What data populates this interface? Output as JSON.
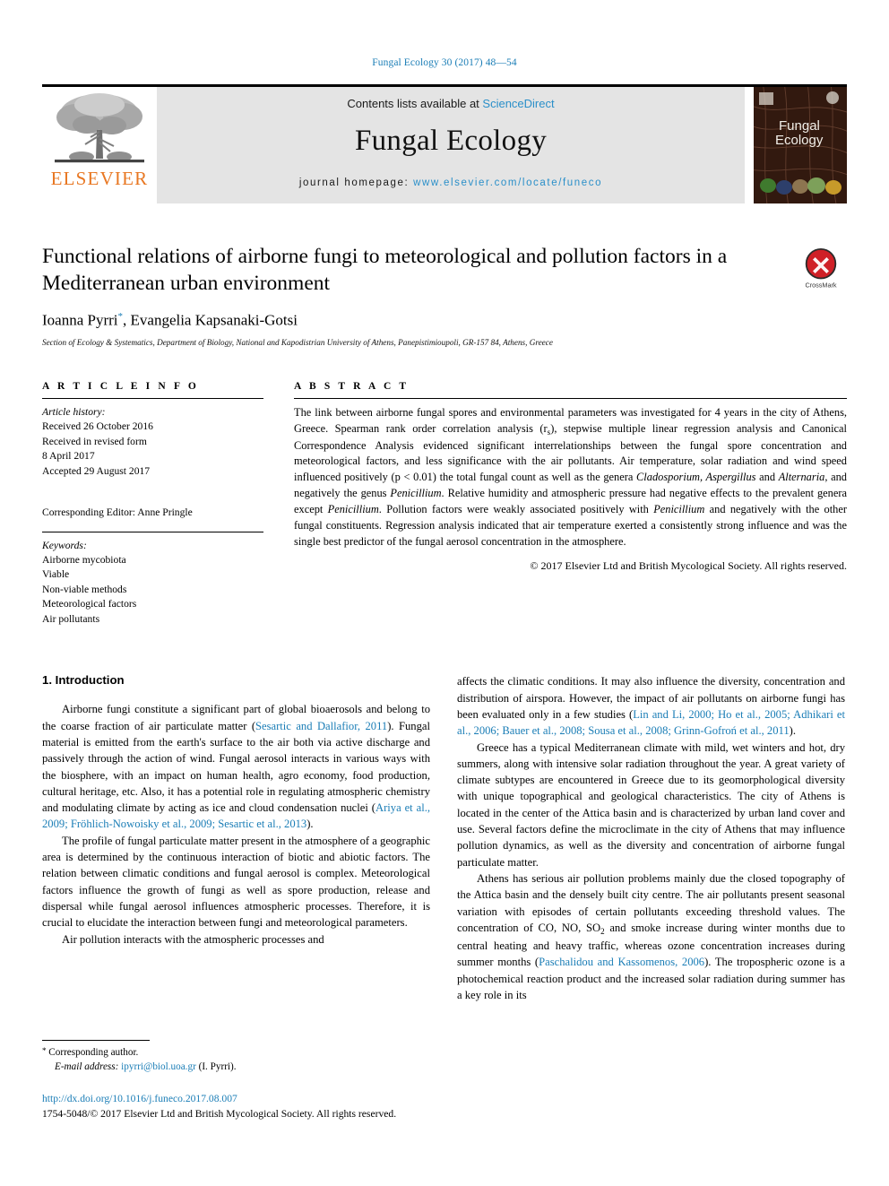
{
  "running_head": "Fungal Ecology 30 (2017) 48—54",
  "masthead": {
    "publisher": "ELSEVIER",
    "contents_prefix": "Contents lists available at ",
    "sciencedirect": "ScienceDirect",
    "journal_name": "Fungal Ecology",
    "homepage_prefix": "journal homepage: ",
    "homepage_url": "www.elsevier.com/locate/funeco",
    "cover_title_line1": "Fungal",
    "cover_title_line2": "Ecology",
    "crossmark_label": "CrossMark"
  },
  "article": {
    "title": "Functional relations of airborne fungi to meteorological and pollution factors in a Mediterranean urban environment",
    "authors": "Ioanna Pyrri",
    "authors_rest": ", Evangelia Kapsanaki-Gotsi",
    "author_marker": "*",
    "affiliation": "Section of Ecology & Systematics, Department of Biology, National and Kapodistrian University of Athens, Panepistimioupoli, GR-157 84, Athens, Greece"
  },
  "info": {
    "heading": "A R T I C L E   I N F O",
    "history_label": "Article history:",
    "history": [
      "Received 26 October 2016",
      "Received in revised form",
      "8 April 2017",
      "Accepted 29 August 2017"
    ],
    "corresponding_editor": "Corresponding Editor: Anne Pringle",
    "keywords_label": "Keywords:",
    "keywords": [
      "Airborne mycobiota",
      "Viable",
      "Non-viable methods",
      "Meteorological factors",
      "Air pollutants"
    ]
  },
  "abstract": {
    "heading": "A B S T R A C T",
    "part1": "The link between airborne fungal spores and environmental parameters was investigated for 4 years in the city of Athens, Greece. Spearman rank order correlation analysis (r",
    "rs_sub": "s",
    "part2": "), stepwise multiple linear regression analysis and Canonical Correspondence Analysis evidenced significant interrelationships between the fungal spore concentration and meteorological factors, and less significance with the air pollutants. Air temperature, solar radiation and wind speed influenced positively (p < 0.01) the total fungal count as well as the genera ",
    "genus1": "Cladosporium, Aspergillus",
    "part3": " and ",
    "genus2": "Alternaria",
    "part4": ", and negatively the genus ",
    "genus3": "Penicillium",
    "part5": ". Relative humidity and atmospheric pressure had negative effects to the prevalent genera except ",
    "genus4": "Penicillium",
    "part6": ". Pollution factors were weakly associated positively with ",
    "genus5": "Penicillium",
    "part7": " and negatively with the other fungal constituents. Regression analysis indicated that air temperature exerted a consistently strong influence and was the single best predictor of the fungal aerosol concentration in the atmosphere.",
    "copyright": "© 2017 Elsevier Ltd and British Mycological Society. All rights reserved."
  },
  "body": {
    "section_number_title": "1. Introduction",
    "left_para1_a": "Airborne fungi constitute a significant part of global bioaerosols and belong to the coarse fraction of air particulate matter (",
    "left_para1_ref1": "Sesartic and Dallafior, 2011",
    "left_para1_b": "). Fungal material is emitted from the earth's surface to the air both via active discharge and passively through the action of wind. Fungal aerosol interacts in various ways with the biosphere, with an impact on human health, agro economy, food production, cultural heritage, etc. Also, it has a potential role in regulating atmospheric chemistry and modulating climate by acting as ice and cloud condensation nuclei (",
    "left_para1_ref2": "Ariya et al., 2009; Fröhlich-Nowoisky et al., 2009; Sesartic et al., 2013",
    "left_para1_c": ").",
    "left_para2": "The profile of fungal particulate matter present in the atmosphere of a geographic area is determined by the continuous interaction of biotic and abiotic factors. The relation between climatic conditions and fungal aerosol is complex. Meteorological factors influence the growth of fungi as well as spore production, release and dispersal while fungal aerosol influences atmospheric processes. Therefore, it is crucial to elucidate the interaction between fungi and meteorological parameters.",
    "left_para3": "Air pollution interacts with the atmospheric processes and",
    "right_para1_a": "affects the climatic conditions. It may also influence the diversity, concentration and distribution of airspora. However, the impact of air pollutants on airborne fungi has been evaluated only in a few studies (",
    "right_para1_ref": "Lin and Li, 2000; Ho et al., 2005; Adhikari et al., 2006; Bauer et al., 2008; Sousa et al., 2008; Grinn-Gofroń et al., 2011",
    "right_para1_b": ").",
    "right_para2": "Greece has a typical Mediterranean climate with mild, wet winters and hot, dry summers, along with intensive solar radiation throughout the year. A great variety of climate subtypes are encountered in Greece due to its geomorphological diversity with unique topographical and geological characteristics. The city of Athens is located in the center of the Attica basin and is characterized by urban land cover and use. Several factors define the microclimate in the city of Athens that may influence pollution dynamics, as well as the diversity and concentration of airborne fungal particulate matter.",
    "right_para3_a": "Athens has serious air pollution problems mainly due the closed topography of the Attica basin and the densely built city centre. The air pollutants present seasonal variation with episodes of certain pollutants exceeding threshold values. The concentration of CO, NO, SO",
    "right_so2_sub": "2",
    "right_para3_b": " and smoke increase during winter months due to central heating and heavy traffic, whereas ozone concentration increases during summer months (",
    "right_para3_ref": "Paschalidou and Kassomenos, 2006",
    "right_para3_c": "). The tropospheric ozone is a photochemical reaction product and the increased solar radiation during summer has a key role in its"
  },
  "footer": {
    "corresponding_marker": "*",
    "corresponding_author": "Corresponding author.",
    "email_label": "E-mail address:",
    "email": "ipyrri@biol.uoa.gr",
    "email_suffix": "(I. Pyrri).",
    "doi": "http://dx.doi.org/10.1016/j.funeco.2017.08.007",
    "issn_line": "1754-5048/© 2017 Elsevier Ltd and British Mycological Society. All rights reserved."
  },
  "colors": {
    "link": "#1a7db6",
    "elsevier_orange": "#e87722",
    "banner_gray": "#e4e4e4",
    "crossmark_red": "#cf2027"
  }
}
